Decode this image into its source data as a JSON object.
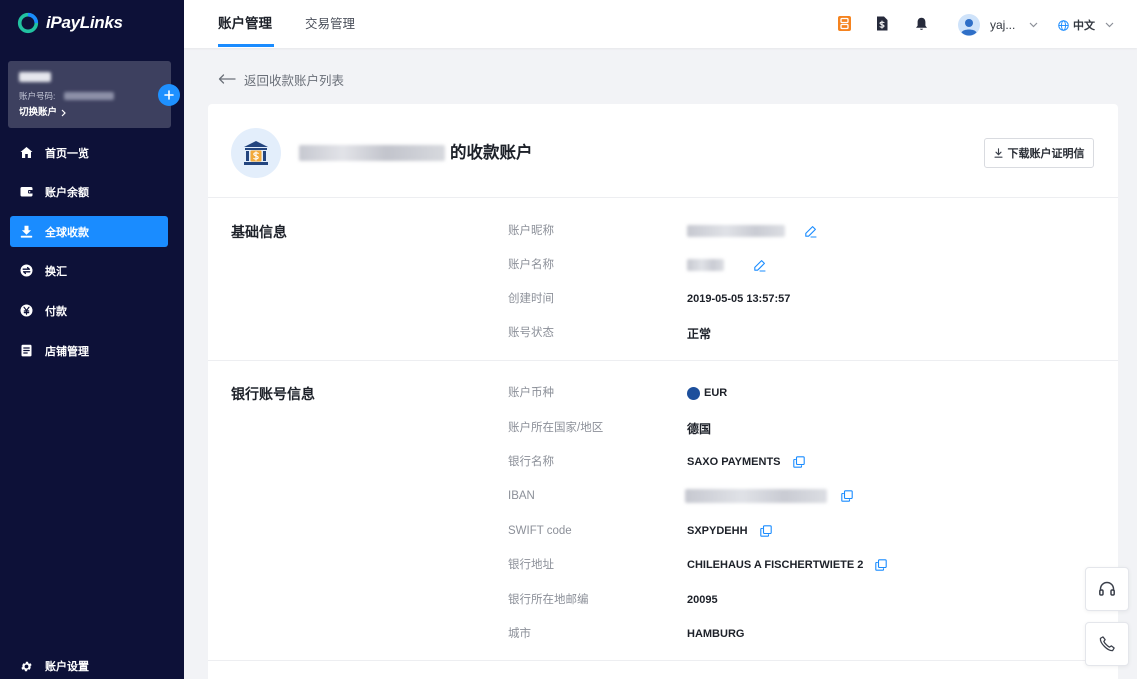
{
  "app": {
    "name": "iPayLinks",
    "logo_icon": "ipaylinks-logo-icon"
  },
  "colors": {
    "sidebar_bg": "#0d1138",
    "accent": "#1a8cff",
    "page_bg": "#f2f3f6",
    "label_text": "#8c9099",
    "value_text": "#1d2129",
    "badge_orange": "#f5831f",
    "eu_blue": "#1d4f9c"
  },
  "sidebar": {
    "account": {
      "number_label": "账户号码:",
      "switch_label": "切换账户",
      "add_icon": "plus-icon"
    },
    "menu": [
      {
        "label": "首页一览",
        "icon": "home-icon",
        "active": false
      },
      {
        "label": "账户余额",
        "icon": "wallet-icon",
        "active": false
      },
      {
        "label": "全球收款",
        "icon": "receive-download-icon",
        "active": true
      },
      {
        "label": "换汇",
        "icon": "exchange-icon",
        "active": false
      },
      {
        "label": "付款",
        "icon": "yen-icon",
        "active": false
      },
      {
        "label": "店铺管理",
        "icon": "document-icon",
        "active": false
      }
    ],
    "settings": {
      "label": "账户设置",
      "icon": "gear-icon"
    }
  },
  "header": {
    "tabs": [
      {
        "label": "账户管理",
        "active": true
      },
      {
        "label": "交易管理",
        "active": false
      }
    ],
    "actions": [
      {
        "icon": "orange-badge-icon"
      },
      {
        "icon": "bill-icon"
      },
      {
        "icon": "bell-icon"
      }
    ],
    "user": {
      "name": "yaj...",
      "avatar": "avatar-icon"
    },
    "language": {
      "label": "中文",
      "icon": "globe-icon"
    }
  },
  "main": {
    "back_link": "返回收款账户列表",
    "account_title_suffix": "的收款账户",
    "download_button": "下载账户证明信",
    "sections": [
      {
        "title": "基础信息",
        "rows": [
          {
            "label": "账户昵称",
            "action_icon": "edit-icon"
          },
          {
            "label": "账户名称",
            "action_icon": "edit-icon"
          },
          {
            "label": "创建时间",
            "value": "2019-05-05 13:57:57"
          },
          {
            "label": "账号状态",
            "value": "正常"
          }
        ]
      },
      {
        "title": "银行账号信息",
        "rows": [
          {
            "label": "账户币种",
            "value": "EUR",
            "icon": "eu-flag-icon"
          },
          {
            "label": "账户所在国家/地区",
            "value": "德国"
          },
          {
            "label": "银行名称",
            "value": "SAXO PAYMENTS",
            "action_icon": "copy-icon"
          },
          {
            "label": "IBAN",
            "action_icon": "copy-icon"
          },
          {
            "label": "SWIFT code",
            "value": "SXPYDEHH",
            "action_icon": "copy-icon"
          },
          {
            "label": "银行地址",
            "value": "CHILEHAUS A FISCHERTWIETE 2",
            "action_icon": "copy-icon"
          },
          {
            "label": "银行所在地邮编",
            "value": "20095"
          },
          {
            "label": "城市",
            "value": "HAMBURG"
          }
        ]
      }
    ]
  },
  "floating": [
    {
      "icon": "headset-icon"
    },
    {
      "icon": "phone-icon"
    }
  ]
}
